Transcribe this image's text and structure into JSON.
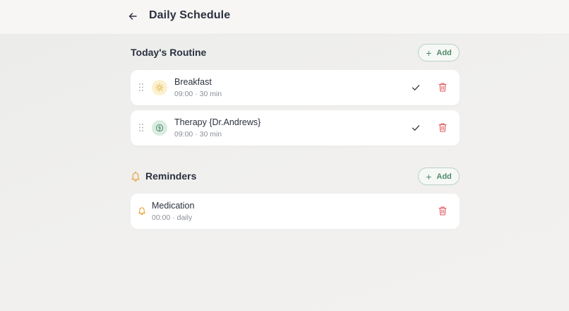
{
  "header": {
    "title": "Daily Schedule"
  },
  "routine": {
    "title": "Today's Routine",
    "add_label": "Add",
    "items": [
      {
        "title": "Breakfast",
        "subtitle": "09:00 · 30 min",
        "icon": "sun-icon"
      },
      {
        "title": "Therapy {Dr.Andrews}",
        "subtitle": "09:00 · 30 min",
        "icon": "tree-icon"
      }
    ]
  },
  "reminders": {
    "title": "Reminders",
    "add_label": "Add",
    "items": [
      {
        "title": "Medication",
        "subtitle": "00:00 · daily",
        "icon": "bell-icon"
      }
    ]
  },
  "colors": {
    "accent": "#4f8c69",
    "danger": "#e0565e",
    "bell": "#e8a23a"
  }
}
